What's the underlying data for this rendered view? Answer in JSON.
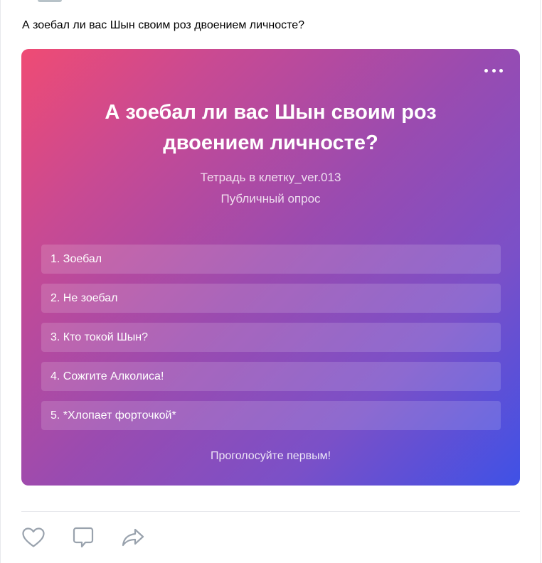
{
  "post": {
    "text": "А зоебал ли вас Шын своим роз двоением личносте?"
  },
  "poll": {
    "title": "А зоебал ли вас Шын своим роз двоением личносте?",
    "author": "Тетрадь в клетку_ver.013",
    "type": "Публичный опрос",
    "options": [
      "1. Зоебал",
      "2. Не зоебал",
      "3. Кто токой Шын?",
      "4. Сожгите Алколиса!",
      "5. *Хлопает форточкой*"
    ],
    "footer": "Проголосуйте первым!",
    "menu_icon": "more-horizontal-icon",
    "gradient_colors": [
      "#ef4b74",
      "#9a4bb0",
      "#3f51e6"
    ]
  },
  "actions": {
    "icons": [
      "heart-icon",
      "comment-icon",
      "share-icon"
    ],
    "icon_color": "#99a2ad"
  }
}
